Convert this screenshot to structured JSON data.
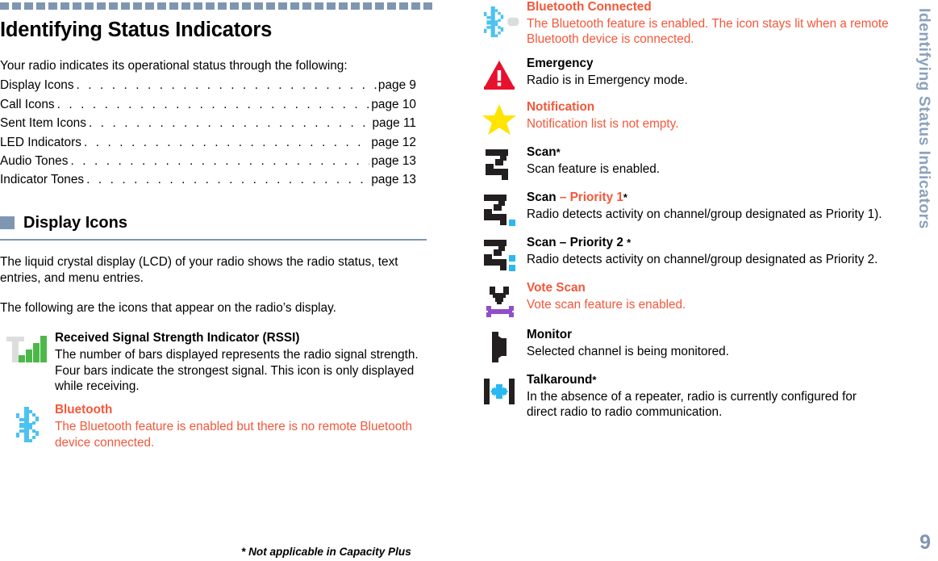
{
  "document": {
    "page_number": "9",
    "sidebar_title": "Identifying Status Indicators",
    "title": "Identifying Status Indicators",
    "intro": "Your radio indicates its operational status through the following:",
    "footnote": "* Not applicable in Capacity Plus",
    "accent_color": "#7f96b2",
    "highlight_color": "#f4573a"
  },
  "toc": [
    {
      "label": "Display Icons",
      "page": "page 9"
    },
    {
      "label": "Call Icons",
      "page": "page 10"
    },
    {
      "label": "Sent Item Icons",
      "page": "page 11"
    },
    {
      "label": "LED Indicators",
      "page": "page 12"
    },
    {
      "label": "Audio Tones",
      "page": "page 13"
    },
    {
      "label": "Indicator Tones",
      "page": "page 13"
    }
  ],
  "section": {
    "heading": "Display Icons",
    "para1": "The liquid crystal display (LCD) of your radio shows the radio status, text entries, and menu entries.",
    "para2": "The following are the icons that appear on the radio’s display."
  },
  "icons_left": [
    {
      "icon": "rssi-icon",
      "title": "Received Signal Strength Indicator (RSSI)",
      "title_color": "#000000",
      "desc": "The number of bars displayed represents the radio signal strength. Four bars indicate the strongest signal. This icon is only displayed while receiving.",
      "desc_color": "#000000"
    },
    {
      "icon": "bluetooth-icon",
      "title": "Bluetooth",
      "title_color": "#f4573a",
      "desc": "The Bluetooth feature is enabled but there is no remote Bluetooth device connected.",
      "desc_color": "#f4573a"
    }
  ],
  "icons_right": [
    {
      "icon": "bluetooth-connected-icon",
      "title": "Bluetooth Connected",
      "title_color": "#f4573a",
      "desc": "The Bluetooth feature is enabled. The icon stays lit when a remote Bluetooth device is connected.",
      "desc_color": "#f4573a"
    },
    {
      "icon": "emergency-icon",
      "title": "Emergency",
      "title_color": "#000000",
      "desc": "Radio is in Emergency mode.",
      "desc_color": "#000000"
    },
    {
      "icon": "notification-star-icon",
      "title": "Notification",
      "title_color": "#f4573a",
      "desc": "Notification list is not empty.",
      "desc_color": "#f4573a"
    },
    {
      "icon": "scan-icon",
      "title": "Scan",
      "title_suffix": "*",
      "title_color": "#000000",
      "desc": "Scan feature is enabled.",
      "desc_color": "#000000"
    },
    {
      "icon": "scan-priority-1-icon",
      "title": "Scan ",
      "title_part2": "– Priority 1",
      "title_suffix": "*",
      "title_color": "#000000",
      "title_part2_color": "#f4573a",
      "desc": "Radio detects activity on channel/group designated as Priority 1).",
      "desc_color": "#000000"
    },
    {
      "icon": "scan-priority-2-icon",
      "title": "Scan – Priority 2 ",
      "title_suffix": "*",
      "title_color": "#000000",
      "desc": "Radio detects activity on channel/group designated as Priority 2.",
      "desc_color": "#000000"
    },
    {
      "icon": "vote-scan-icon",
      "title": "Vote Scan",
      "title_color": "#f4573a",
      "desc": "Vote scan feature is enabled.",
      "desc_color": "#f4573a"
    },
    {
      "icon": "monitor-icon",
      "title": "Monitor",
      "title_color": "#000000",
      "desc": "Selected channel is being monitored.",
      "desc_color": "#000000"
    },
    {
      "icon": "talkaround-icon",
      "title": "Talkaround",
      "title_suffix": "*",
      "title_color": "#000000",
      "desc": "In the absence of a repeater, radio is currently configured for direct radio to radio communication.",
      "desc_color": "#000000"
    }
  ]
}
